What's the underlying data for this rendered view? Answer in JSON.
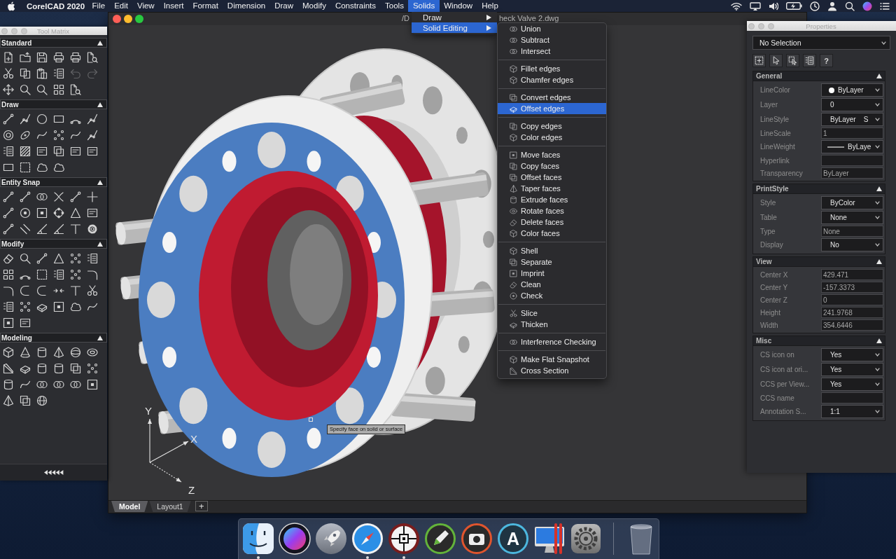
{
  "menubar": {
    "app": "CorelCAD 2020",
    "menus": [
      {
        "label": "File",
        "selected": false
      },
      {
        "label": "Edit",
        "selected": false
      },
      {
        "label": "View",
        "selected": false
      },
      {
        "label": "Insert",
        "selected": false
      },
      {
        "label": "Format",
        "selected": false
      },
      {
        "label": "Dimension",
        "selected": false
      },
      {
        "label": "Draw",
        "selected": false
      },
      {
        "label": "Modify",
        "selected": false
      },
      {
        "label": "Constraints",
        "selected": false
      },
      {
        "label": "Tools",
        "selected": false
      },
      {
        "label": "Solids",
        "selected": true
      },
      {
        "label": "Window",
        "selected": false
      },
      {
        "label": "Help",
        "selected": false
      }
    ]
  },
  "solids_menu": {
    "items": [
      {
        "label": "Draw",
        "selected": false
      },
      {
        "label": "Solid Editing",
        "selected": true
      }
    ]
  },
  "solid_editing_menu": {
    "groups": [
      {
        "items": [
          {
            "label": "Union",
            "kind": "circles",
            "selected": false
          },
          {
            "label": "Subtract",
            "kind": "circles",
            "selected": false
          },
          {
            "label": "Intersect",
            "kind": "circles",
            "selected": false
          }
        ]
      },
      {
        "items": [
          {
            "label": "Fillet edges",
            "kind": "cube",
            "selected": false
          },
          {
            "label": "Chamfer edges",
            "kind": "cube",
            "selected": false
          }
        ]
      },
      {
        "items": [
          {
            "label": "Convert edges",
            "kind": "squares",
            "selected": false
          },
          {
            "label": "Offset edges",
            "kind": "slab",
            "selected": true
          }
        ]
      },
      {
        "items": [
          {
            "label": "Copy edges",
            "kind": "copy",
            "selected": false
          },
          {
            "label": "Color edges",
            "kind": "cube",
            "selected": false
          }
        ]
      },
      {
        "items": [
          {
            "label": "Move faces",
            "kind": "framedot",
            "selected": false
          },
          {
            "label": "Copy faces",
            "kind": "copy",
            "selected": false
          },
          {
            "label": "Offset faces",
            "kind": "squares",
            "selected": false
          },
          {
            "label": "Taper faces",
            "kind": "pyramid",
            "selected": false
          },
          {
            "label": "Extrude faces",
            "kind": "cylinder",
            "selected": false
          },
          {
            "label": "Rotate faces",
            "kind": "torus",
            "selected": false
          },
          {
            "label": "Delete faces",
            "kind": "eraser",
            "selected": false
          },
          {
            "label": "Color faces",
            "kind": "cube",
            "selected": false
          }
        ]
      },
      {
        "items": [
          {
            "label": "Shell",
            "kind": "cube",
            "selected": false
          },
          {
            "label": "Separate",
            "kind": "squares",
            "selected": false
          },
          {
            "label": "Imprint",
            "kind": "framedot",
            "selected": false
          },
          {
            "label": "Clean",
            "kind": "eraser",
            "selected": false
          },
          {
            "label": "Check",
            "kind": "target",
            "selected": false
          }
        ]
      },
      {
        "items": [
          {
            "label": "Slice",
            "kind": "scissors",
            "selected": false
          },
          {
            "label": "Thicken",
            "kind": "slab",
            "selected": false
          }
        ]
      },
      {
        "items": [
          {
            "label": "Interference Checking",
            "kind": "circles",
            "selected": false
          }
        ]
      },
      {
        "items": [
          {
            "label": "Make Flat Snapshot",
            "kind": "cube",
            "selected": false
          },
          {
            "label": "Cross Section",
            "kind": "wedge",
            "selected": false
          }
        ]
      }
    ]
  },
  "tool_matrix": {
    "title": "Tool Matrix",
    "sections": [
      {
        "title": "Standard",
        "expanded": true,
        "tools": [
          {
            "kind": "page",
            "disabled": false
          },
          {
            "kind": "folder",
            "disabled": false
          },
          {
            "kind": "floppy",
            "disabled": false
          },
          {
            "kind": "printer",
            "disabled": false
          },
          {
            "kind": "printer",
            "disabled": false
          },
          {
            "kind": "preview",
            "disabled": false
          },
          {
            "kind": "scissors",
            "disabled": false
          },
          {
            "kind": "copy",
            "disabled": false
          },
          {
            "kind": "clipboard",
            "disabled": false
          },
          {
            "kind": "list",
            "disabled": false
          },
          {
            "kind": "undo",
            "disabled": true
          },
          {
            "kind": "redo",
            "disabled": true
          },
          {
            "kind": "pan",
            "disabled": false
          },
          {
            "kind": "zoom",
            "disabled": false
          },
          {
            "kind": "zoom",
            "disabled": false
          },
          {
            "kind": "grid",
            "disabled": false
          },
          {
            "kind": "preview",
            "disabled": false
          }
        ]
      },
      {
        "title": "Draw",
        "expanded": true,
        "tools": [
          {
            "kind": "segment"
          },
          {
            "kind": "chain"
          },
          {
            "kind": "circle"
          },
          {
            "kind": "rectangle"
          },
          {
            "kind": "arc"
          },
          {
            "kind": "chain"
          },
          {
            "kind": "ring"
          },
          {
            "kind": "ellipse"
          },
          {
            "kind": "spline"
          },
          {
            "kind": "dots"
          },
          {
            "kind": "spline"
          },
          {
            "kind": "chain"
          },
          {
            "kind": "list"
          },
          {
            "kind": "hatch"
          },
          {
            "kind": "textbox"
          },
          {
            "kind": "squares"
          },
          {
            "kind": "textbox"
          },
          {
            "kind": "textbox"
          },
          {
            "kind": "rectangle"
          },
          {
            "kind": "dashsquare"
          },
          {
            "kind": "cloud"
          },
          {
            "kind": "cloud"
          }
        ]
      },
      {
        "title": "Entity Snap",
        "expanded": true,
        "tools": [
          {
            "kind": "segment"
          },
          {
            "kind": "segment"
          },
          {
            "kind": "circles"
          },
          {
            "kind": "cross"
          },
          {
            "kind": "segment"
          },
          {
            "kind": "plus"
          },
          {
            "kind": "segment"
          },
          {
            "kind": "target"
          },
          {
            "kind": "framedot"
          },
          {
            "kind": "quadrant"
          },
          {
            "kind": "triangle"
          },
          {
            "kind": "textbox"
          },
          {
            "kind": "segment"
          },
          {
            "kind": "parallel"
          },
          {
            "kind": "angle"
          },
          {
            "kind": "angle"
          },
          {
            "kind": "tee"
          },
          {
            "kind": "gear"
          }
        ]
      },
      {
        "title": "Modify",
        "expanded": true,
        "tools": [
          {
            "kind": "eraser"
          },
          {
            "kind": "zoom"
          },
          {
            "kind": "segment"
          },
          {
            "kind": "triangle"
          },
          {
            "kind": "dots"
          },
          {
            "kind": "list"
          },
          {
            "kind": "grid"
          },
          {
            "kind": "arc"
          },
          {
            "kind": "dashsquare"
          },
          {
            "kind": "list"
          },
          {
            "kind": "dots"
          },
          {
            "kind": "corner"
          },
          {
            "kind": "corner"
          },
          {
            "kind": "halfcircle"
          },
          {
            "kind": "halfcircle"
          },
          {
            "kind": "arrows"
          },
          {
            "kind": "tee"
          },
          {
            "kind": "scissors"
          },
          {
            "kind": "list"
          },
          {
            "kind": "dots"
          },
          {
            "kind": "slab"
          },
          {
            "kind": "framedot"
          },
          {
            "kind": "cloud"
          },
          {
            "kind": "spline"
          },
          {
            "kind": "framedot"
          },
          {
            "kind": "textbox"
          }
        ]
      },
      {
        "title": "Modeling",
        "expanded": true,
        "tools": [
          {
            "kind": "cube"
          },
          {
            "kind": "cone"
          },
          {
            "kind": "cylinder"
          },
          {
            "kind": "pyramid"
          },
          {
            "kind": "sphere"
          },
          {
            "kind": "torus"
          },
          {
            "kind": "wedge"
          },
          {
            "kind": "slab"
          },
          {
            "kind": "cylinder"
          },
          {
            "kind": "cylinder"
          },
          {
            "kind": "squares"
          },
          {
            "kind": "dots"
          },
          {
            "kind": "cylinder"
          },
          {
            "kind": "spline"
          },
          {
            "kind": "circles"
          },
          {
            "kind": "circles"
          },
          {
            "kind": "circles"
          },
          {
            "kind": "framedot"
          },
          {
            "kind": "pyramid"
          },
          {
            "kind": "squares"
          },
          {
            "kind": "globe"
          }
        ]
      }
    ]
  },
  "drawing_window": {
    "title_fragments": [
      "/D",
      "heck Valve 2.dwg"
    ],
    "axes": [
      {
        "label": "Y",
        "kind": "solid"
      },
      {
        "label": "X",
        "kind": "solid"
      },
      {
        "label": "Z",
        "kind": "dotted"
      }
    ],
    "tooltip": "Specify face on solid or surface",
    "tabs": [
      {
        "label": "Model",
        "selected": true
      },
      {
        "label": "Layout1",
        "selected": false
      }
    ],
    "new_tab": "+"
  },
  "properties": {
    "title": "Properties",
    "selection": "No Selection",
    "tools": [
      {
        "kind": "dashframe"
      },
      {
        "kind": "pointer"
      },
      {
        "kind": "dashpointer"
      },
      {
        "kind": "list"
      },
      {
        "kind": "help",
        "label": "?"
      }
    ],
    "sections": [
      {
        "title": "General",
        "expanded": true,
        "rows": [
          {
            "label": "LineColor",
            "kind": "color",
            "value": "ByLayer",
            "color": "#ffffff"
          },
          {
            "label": "Layer",
            "kind": "dropdown",
            "value": "0"
          },
          {
            "label": "LineStyle",
            "kind": "dropdown",
            "value": "ByLayer    S"
          },
          {
            "label": "LineScale",
            "kind": "input",
            "value": "1"
          },
          {
            "label": "LineWeight",
            "kind": "weight",
            "value": "ByLaye"
          },
          {
            "label": "Hyperlink",
            "kind": "input"
          },
          {
            "label": "Transparency",
            "kind": "input",
            "value": "ByLayer"
          }
        ]
      },
      {
        "title": "PrintStyle",
        "expanded": true,
        "rows": [
          {
            "label": "Style",
            "kind": "dropdown",
            "value": "ByColor"
          },
          {
            "label": "Table",
            "kind": "dropdown",
            "value": "None"
          },
          {
            "label": "Type",
            "kind": "input",
            "value": "None"
          },
          {
            "label": "Display",
            "kind": "dropdown",
            "value": "No"
          }
        ]
      },
      {
        "title": "View",
        "expanded": true,
        "rows": [
          {
            "label": "Center X",
            "kind": "input",
            "value": "429.471"
          },
          {
            "label": "Center Y",
            "kind": "input",
            "value": "-157.3373"
          },
          {
            "label": "Center Z",
            "kind": "input",
            "value": "0"
          },
          {
            "label": "Height",
            "kind": "input",
            "value": "241.9768"
          },
          {
            "label": "Width",
            "kind": "input",
            "value": "354.6446"
          }
        ]
      },
      {
        "title": "Misc",
        "expanded": true,
        "rows": [
          {
            "label": "CS icon on",
            "kind": "dropdown",
            "value": "Yes"
          },
          {
            "label": "CS icon at ori...",
            "kind": "dropdown",
            "value": "Yes"
          },
          {
            "label": "CCS per View...",
            "kind": "dropdown",
            "value": "Yes"
          },
          {
            "label": "CCS name",
            "kind": "input"
          },
          {
            "label": "Annotation S...",
            "kind": "dropdown",
            "value": "1:1"
          }
        ]
      }
    ]
  },
  "dock": {
    "apps": [
      {
        "kind": "finder",
        "running": true
      },
      {
        "kind": "orb",
        "running": false
      },
      {
        "kind": "rocket",
        "running": false
      },
      {
        "kind": "compass",
        "running": true
      },
      {
        "kind": "crosshair",
        "running": true
      },
      {
        "kind": "pen",
        "running": false
      },
      {
        "kind": "camera",
        "running": false
      },
      {
        "kind": "letter",
        "glyph": "A",
        "running": false
      },
      {
        "kind": "monitor",
        "running": false
      },
      {
        "kind": "cog",
        "running": false
      },
      {
        "kind": "trash",
        "running": false
      }
    ]
  }
}
